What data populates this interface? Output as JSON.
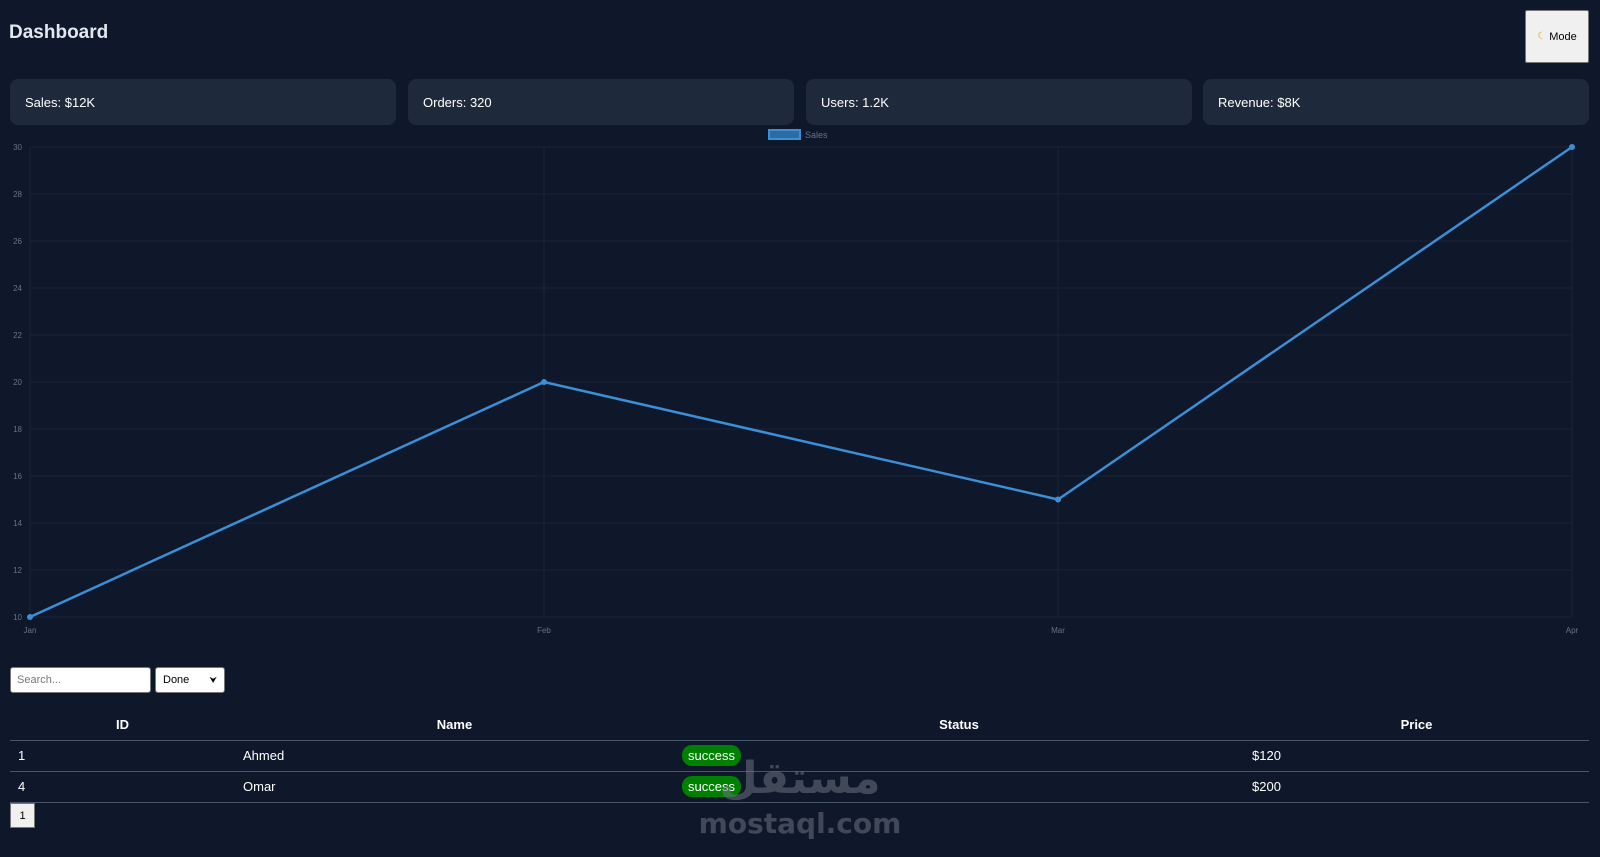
{
  "header": {
    "title": "Dashboard",
    "mode_label": "Mode",
    "mode_icon": "moon-icon"
  },
  "cards": [
    {
      "label": "Sales: $12K"
    },
    {
      "label": "Orders: 320"
    },
    {
      "label": "Users: 1.2K"
    },
    {
      "label": "Revenue: $8K"
    }
  ],
  "chart_data": {
    "type": "line",
    "categories": [
      "Jan",
      "Feb",
      "Mar",
      "Apr"
    ],
    "series": [
      {
        "name": "Sales",
        "values": [
          10,
          20,
          15,
          30
        ],
        "color": "#3b8fd6"
      }
    ],
    "ylim": [
      10,
      30
    ],
    "yticks": [
      10,
      12,
      14,
      16,
      18,
      20,
      22,
      24,
      26,
      28,
      30
    ],
    "legend": "top-center",
    "grid": true
  },
  "filters": {
    "search_placeholder": "Search...",
    "status_selected": "Done"
  },
  "table": {
    "headers": [
      "ID",
      "Name",
      "Status",
      "Price"
    ],
    "rows": [
      {
        "id": "1",
        "name": "Ahmed",
        "status": "success",
        "price": "$120"
      },
      {
        "id": "4",
        "name": "Omar",
        "status": "success",
        "price": "$200"
      }
    ],
    "status_color": "#008000"
  },
  "pagination": {
    "current_page": "1"
  },
  "watermark": {
    "arabic": "مستقل",
    "latin": "mostaql.com"
  }
}
